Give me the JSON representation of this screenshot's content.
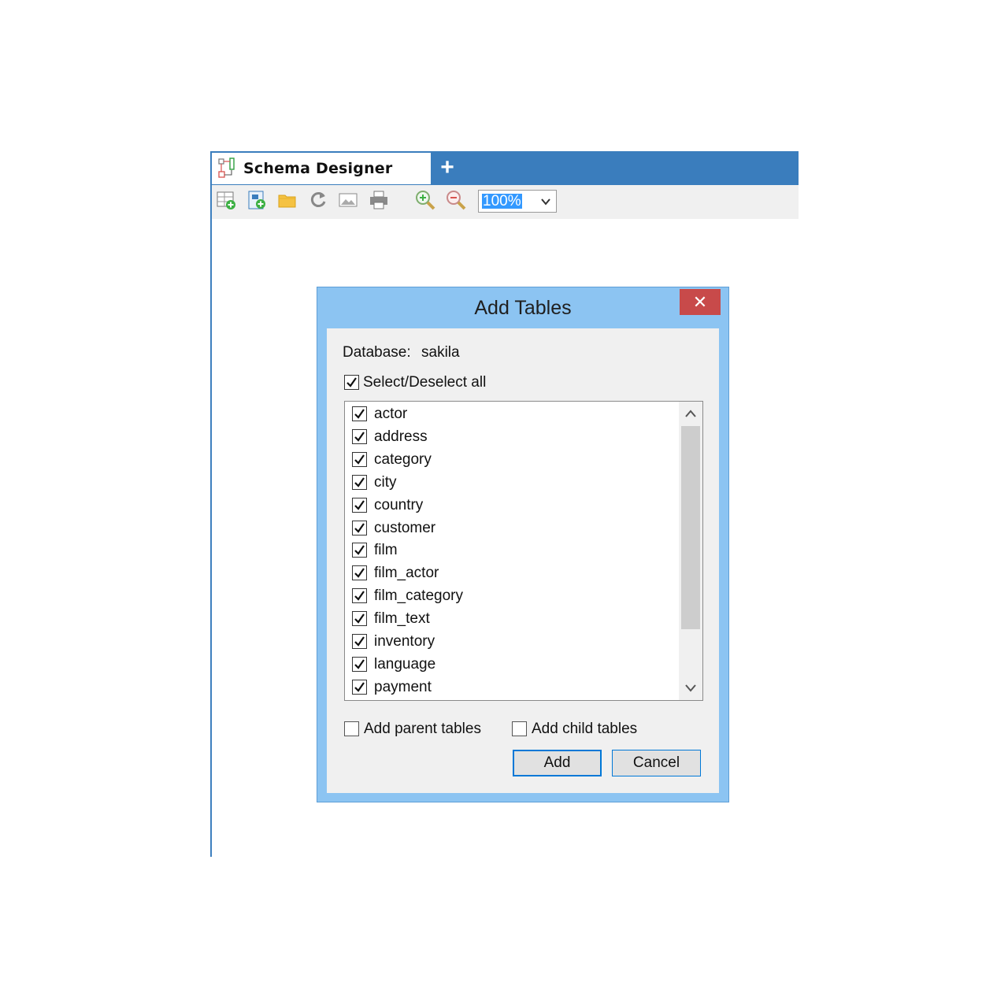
{
  "tab": {
    "title": "Schema Designer",
    "new_tab_label": "+"
  },
  "toolbar": {
    "buttons": [
      "add-table-icon",
      "new-diagram-icon",
      "open-folder-icon",
      "refresh-icon",
      "export-image-icon",
      "print-icon",
      "zoom-in-icon",
      "zoom-out-icon"
    ],
    "zoom_value": "100%"
  },
  "dialog": {
    "title": "Add Tables",
    "close_label": "✕",
    "database_label": "Database:",
    "database_value": "sakila",
    "select_all_label": "Select/Deselect all",
    "select_all_checked": true,
    "tables": [
      {
        "name": "actor",
        "checked": true
      },
      {
        "name": "address",
        "checked": true
      },
      {
        "name": "category",
        "checked": true
      },
      {
        "name": "city",
        "checked": true
      },
      {
        "name": "country",
        "checked": true
      },
      {
        "name": "customer",
        "checked": true
      },
      {
        "name": "film",
        "checked": true
      },
      {
        "name": "film_actor",
        "checked": true
      },
      {
        "name": "film_category",
        "checked": true
      },
      {
        "name": "film_text",
        "checked": true
      },
      {
        "name": "inventory",
        "checked": true
      },
      {
        "name": "language",
        "checked": true
      },
      {
        "name": "payment",
        "checked": true
      }
    ],
    "add_parent_label": "Add parent tables",
    "add_parent_checked": false,
    "add_child_label": "Add child tables",
    "add_child_checked": false,
    "add_button": "Add",
    "cancel_button": "Cancel"
  },
  "colors": {
    "tab_strip": "#3a7dbd",
    "dialog_frame": "#8cc4f2",
    "close_button": "#c84a4a",
    "zoom_highlight": "#3399ff"
  }
}
